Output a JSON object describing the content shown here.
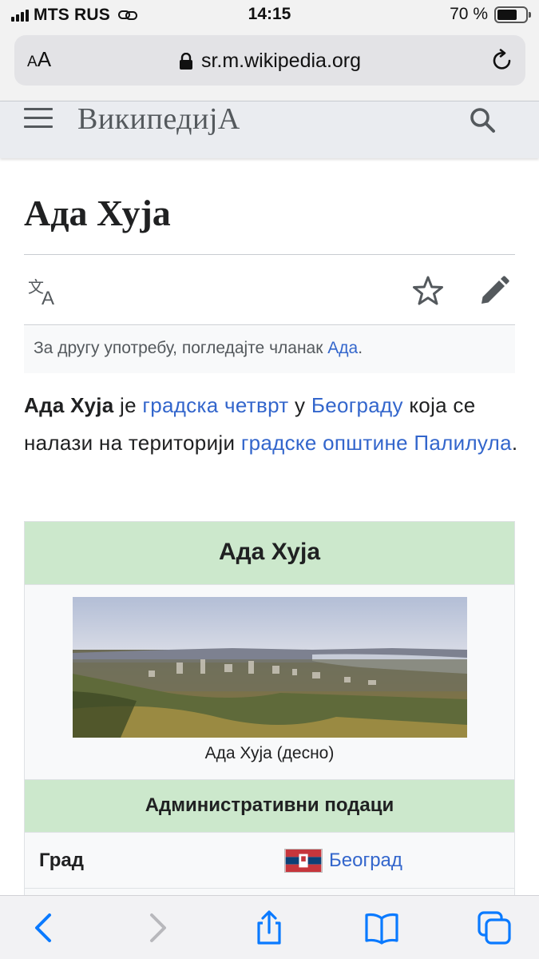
{
  "status_bar": {
    "carrier": "MTS RUS",
    "time": "14:15",
    "battery_percent": "70 %",
    "battery_level": 0.7,
    "signal_bars": 4
  },
  "browser": {
    "text_size_label_small": "A",
    "text_size_label_big": "A",
    "url": "sr.m.wikipedia.org",
    "icons": [
      "lock-icon",
      "reload-icon",
      "back-icon",
      "forward-icon",
      "share-icon",
      "bookmarks-icon",
      "tabs-icon"
    ]
  },
  "wiki_header": {
    "wordmark": "ВикипедијА",
    "icons": [
      "menu-icon",
      "search-icon"
    ]
  },
  "article": {
    "title": "Ада Хуја",
    "hatnote": {
      "prefix": "За другу употребу, погледајте чланак ",
      "link": "Ада",
      "suffix": "."
    },
    "lead": {
      "bold": "Ада Хуја",
      "t1": " је ",
      "link1": "градска четврт",
      "t2": " у ",
      "link2": "Београду",
      "t3": " која се налази на територији ",
      "link3": "градске општине Палилула",
      "t4": "."
    },
    "action_icons": [
      "translate-icon",
      "star-icon",
      "edit-icon"
    ]
  },
  "infobox": {
    "title": "Ада Хуја",
    "image_caption": "Ада Хуја (десно)",
    "section_header": "Административни подаци",
    "rows": [
      {
        "label": "Град",
        "value": "Београд",
        "flag": "belgrade-flag"
      }
    ]
  },
  "colors": {
    "link": "#3366cc",
    "infobox_header": "#cce8cc",
    "header_bg": "#eaecf0",
    "ios_blue": "#0a7aff"
  }
}
